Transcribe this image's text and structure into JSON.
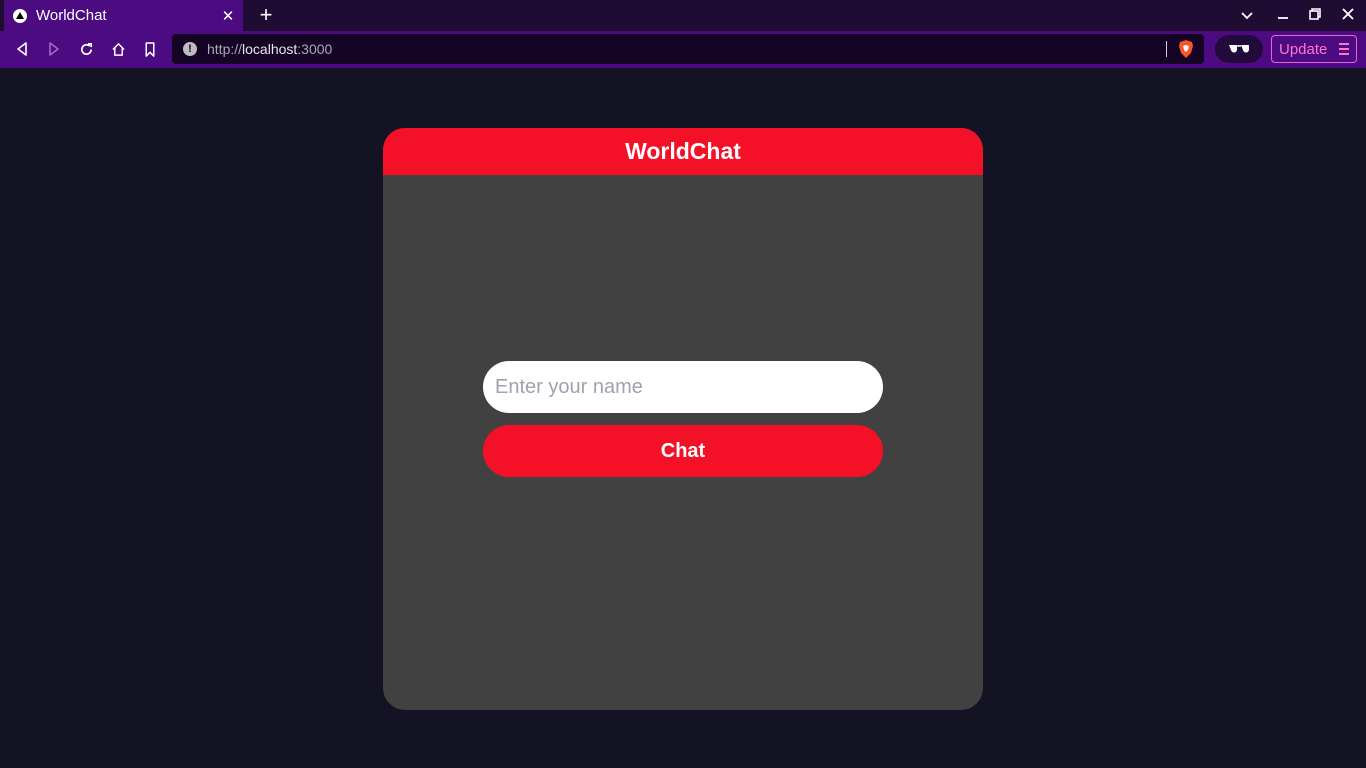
{
  "browser": {
    "tab": {
      "title": "WorldChat"
    },
    "new_tab_label": "+",
    "address": {
      "scheme": "http://",
      "host": "localhost",
      "port": ":3000"
    },
    "update_label": "Update"
  },
  "app": {
    "title": "WorldChat",
    "name_input": {
      "placeholder": "Enter your name",
      "value": ""
    },
    "chat_button_label": "Chat"
  },
  "colors": {
    "page_background": "#131324",
    "card_background": "#414141",
    "accent": "#f41127",
    "browser_toolbar": "#4d0b82"
  }
}
